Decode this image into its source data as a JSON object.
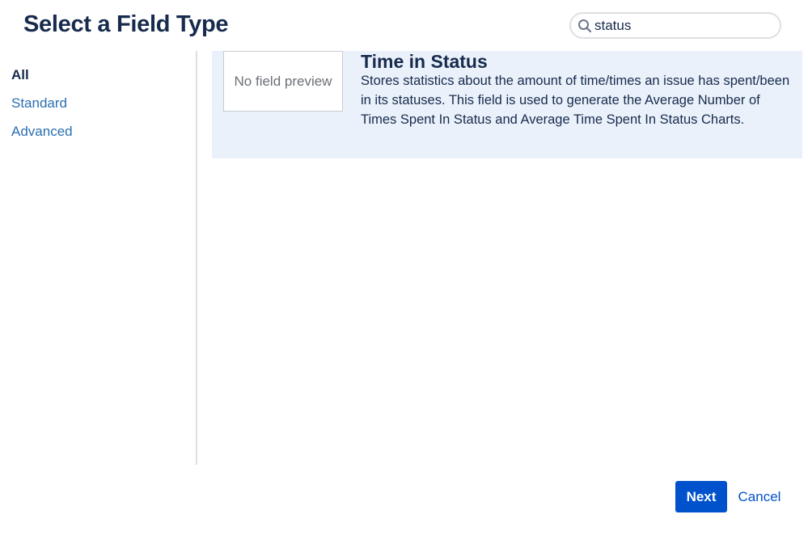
{
  "dialog": {
    "title": "Select a Field Type"
  },
  "search": {
    "value": "status",
    "icon": "search-icon"
  },
  "sidebar": {
    "items": [
      {
        "label": "All",
        "active": true
      },
      {
        "label": "Standard",
        "active": false
      },
      {
        "label": "Advanced",
        "active": false
      }
    ]
  },
  "results": [
    {
      "preview_text": "No field preview",
      "name": "Time in Status",
      "description": "Stores statistics about the amount of time/times an issue has spent/been in its statuses. This field is used to generate the Average Number of Times Spent In Status and Average Time Spent In Status Charts.",
      "selected": true
    }
  ],
  "footer": {
    "next_label": "Next",
    "cancel_label": "Cancel"
  },
  "colors": {
    "title": "#172b4d",
    "link": "#2b6fb0",
    "primary_button": "#0052cc",
    "selected_row": "#eaf1fa",
    "divider": "#dcdfe4"
  }
}
